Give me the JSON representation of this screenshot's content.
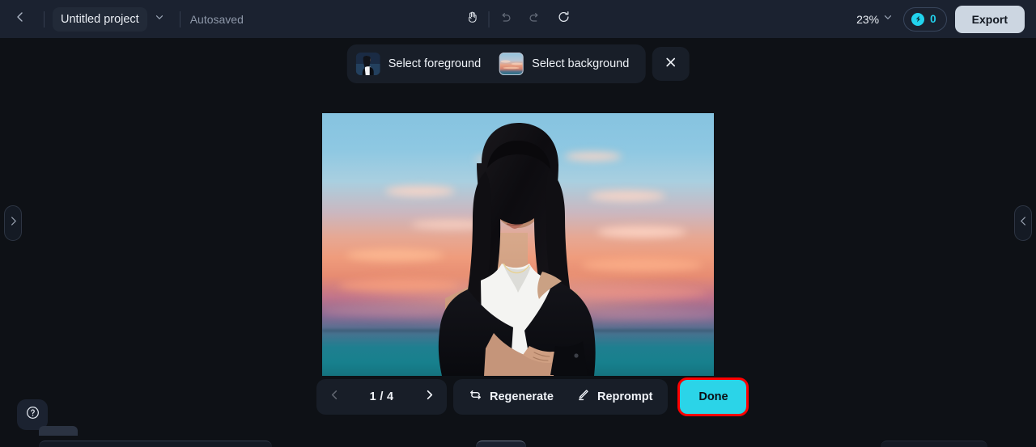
{
  "topbar": {
    "back_icon": "chevron-left-icon",
    "project_name": "Untitled project",
    "project_caret_icon": "chevron-down-icon",
    "autosaved_label": "Autosaved",
    "tools": [
      {
        "name": "hand-tool",
        "icon": "hand-icon",
        "dim": false
      },
      {
        "name": "undo",
        "icon": "undo-icon",
        "dim": true
      },
      {
        "name": "redo",
        "icon": "redo-icon",
        "dim": true
      },
      {
        "name": "refresh",
        "icon": "refresh-icon",
        "dim": false
      }
    ],
    "zoom_level": "23%",
    "zoom_caret_icon": "chevron-down-icon",
    "credits_icon": "credit-coin-icon",
    "credits_count": "0",
    "export_label": "Export"
  },
  "selectbar": {
    "foreground_label": "Select foreground",
    "foreground_thumb": "person-thumbnail",
    "background_label": "Select background",
    "background_thumb": "sunset-sky-thumbnail",
    "close_icon": "close-icon"
  },
  "canvas": {
    "image_alt": "woman with long dark hair in white top and black jacket against sunset sky with sun rays over ocean"
  },
  "bottombar": {
    "prev_icon": "chevron-left-icon",
    "page_label": "1 / 4",
    "next_icon": "chevron-right-icon",
    "regenerate_label": "Regenerate",
    "regenerate_icon": "refresh-cycle-icon",
    "reprompt_label": "Reprompt",
    "reprompt_icon": "pencil-icon",
    "done_label": "Done"
  },
  "edges": {
    "left_handle_icon": "chevron-right-icon",
    "right_handle_icon": "chevron-left-icon"
  },
  "help": {
    "icon": "question-circle-icon"
  },
  "colors": {
    "accent_cyan": "#2bd4e8",
    "highlight_red": "#ff0000",
    "export_bg": "#ccd6e1",
    "topbar_bg": "#1b2230",
    "canvas_bg": "#0e1116"
  }
}
